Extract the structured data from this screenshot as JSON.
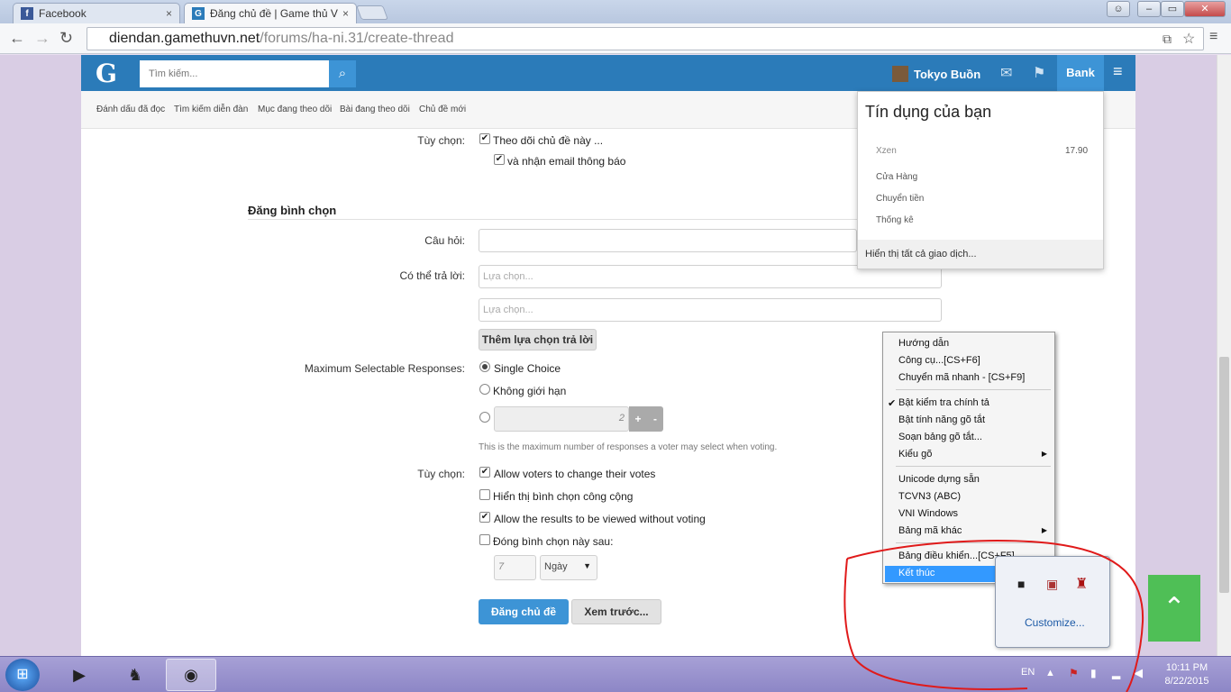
{
  "browser": {
    "tabs": [
      {
        "title": "Facebook",
        "close": "×"
      },
      {
        "title": "Đăng chủ đề | Game thủ V",
        "close": "×"
      }
    ],
    "url_host": "diendan.gamethuvn.net",
    "url_path": "/forums/ha-ni.31/create-thread"
  },
  "header": {
    "logo": "G",
    "search_placeholder": "Tìm kiếm...",
    "username": "Tokyo Buồn",
    "bank": "Bank"
  },
  "subnav": [
    "Đánh dấu đã đọc",
    "Tìm kiếm diễn đàn",
    "Mục đang theo dõi",
    "Bài đang theo dõi",
    "Chủ đề mới"
  ],
  "options_top": {
    "label": "Tùy chọn:",
    "watch": "Theo dõi chủ đề này ...",
    "email": "và nhận email thông báo"
  },
  "poll": {
    "heading": "Đăng bình chọn",
    "question_label": "Câu hỏi:",
    "responses_label": "Có thể trả lời:",
    "choice_placeholder": "Lựa chọn...",
    "add_choice": "Thêm lựa chọn trả lời",
    "max_label": "Maximum Selectable Responses:",
    "single": "Single Choice",
    "unlimited": "Không giới hạn",
    "count_value": "2",
    "hint": "This is the maximum number of responses a voter may select when voting.",
    "options_label": "Tùy chọn:",
    "allow_change": "Allow voters to change their votes",
    "public": "Hiển thị bình chọn công cộng",
    "view_results": "Allow the results to be viewed without voting",
    "close_after": "Đóng bình chọn này sau:",
    "close_value": "7",
    "close_unit": "Ngày",
    "submit": "Đăng chủ đề",
    "preview": "Xem trước..."
  },
  "credit": {
    "title": "Tín dụng của bạn",
    "currency": "Xzen",
    "amount": "17.90",
    "shop": "Cửa Hàng",
    "transfer": "Chuyển tiền",
    "stats": "Thống kê",
    "show_all": "Hiển thị tất cả giao dịch..."
  },
  "context_menu": {
    "items": [
      "Hướng dẫn",
      "Công cụ...[CS+F6]",
      "Chuyển mã nhanh - [CS+F9]",
      "Bật kiểm tra chính tả",
      "Bật tính năng gõ tắt",
      "Soạn bảng gõ tắt...",
      "Kiểu gõ",
      "Unicode dựng sẵn",
      "TCVN3 (ABC)",
      "VNI Windows",
      "Bảng mã khác",
      "Bảng điều khiển...[CS+F5]",
      "Kết thúc"
    ]
  },
  "tray": {
    "customize": "Customize..."
  },
  "taskbar": {
    "lang": "EN",
    "time": "10:11 PM",
    "date": "8/22/2015"
  }
}
